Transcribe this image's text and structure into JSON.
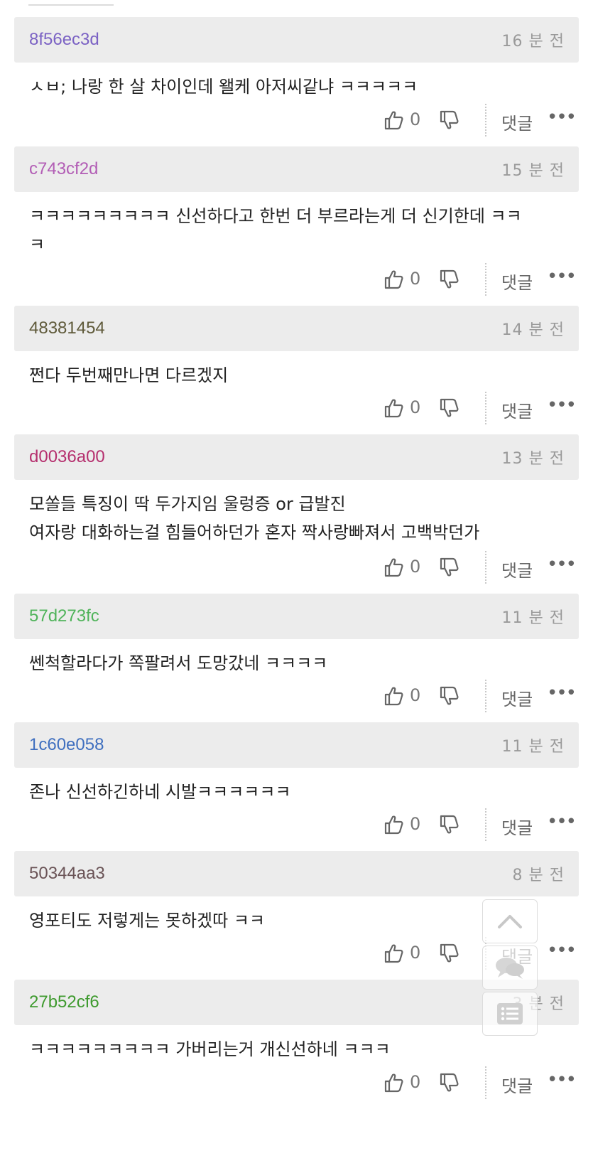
{
  "comments": [
    {
      "user": "8f56ec3d",
      "user_color": "#7b62c4",
      "time": "16 분 전",
      "text": "ㅅㅂ; 나랑 한 살 차이인데 왤케 아저씨같냐 ㅋㅋㅋㅋㅋ",
      "likes": "0",
      "reply_label": "댓글",
      "more_label": "•••"
    },
    {
      "user": "c743cf2d",
      "user_color": "#b25db5",
      "time": "15 분 전",
      "text": "ㅋㅋㅋㅋㅋㅋㅋㅋㅋ 신선하다고 한번 더 부르라는게 더 신기한데 ㅋㅋ\nㅋ",
      "likes": "0",
      "reply_label": "댓글",
      "more_label": "•••"
    },
    {
      "user": "48381454",
      "user_color": "#5f5a3a",
      "time": "14 분 전",
      "text": "쩐다 두번째만나면 다르겠지",
      "likes": "0",
      "reply_label": "댓글",
      "more_label": "•••"
    },
    {
      "user": "d0036a00",
      "user_color": "#b52f6e",
      "time": "13 분 전",
      "text": "모쏠들 특징이 딱 두가지임 울렁증 or 급발진\n여자랑 대화하는걸 힘들어하던가 혼자 짝사랑빠져서 고백박던가",
      "likes": "0",
      "reply_label": "댓글",
      "more_label": "•••"
    },
    {
      "user": "57d273fc",
      "user_color": "#4fb35a",
      "time": "11 분 전",
      "text": "쎈척할라다가 쪽팔려서 도망갔네 ㅋㅋㅋㅋ",
      "likes": "0",
      "reply_label": "댓글",
      "more_label": "•••"
    },
    {
      "user": "1c60e058",
      "user_color": "#3f6fbf",
      "time": "11 분 전",
      "text": "존나 신선하긴하네 시발ㅋㅋㅋㅋㅋㅋ",
      "likes": "0",
      "reply_label": "댓글",
      "more_label": "•••"
    },
    {
      "user": "50344aa3",
      "user_color": "#6a5356",
      "time": "8 분 전",
      "text": "영포티도 저렇게는 못하겠따 ㅋㅋ",
      "likes": "0",
      "reply_label": "댓글",
      "more_label": "•••"
    },
    {
      "user": "27b52cf6",
      "user_color": "#3e9a2e",
      "time": "3 분 전",
      "text": "ㅋㅋㅋㅋㅋㅋㅋㅋㅋ 가버리는거 개신선하네 ㅋㅋㅋ",
      "likes": "0",
      "reply_label": "댓글",
      "more_label": "•••"
    }
  ],
  "floating": {
    "top_icon": "chevron-up-icon",
    "comments_icon": "chat-bubbles-icon",
    "list_icon": "list-icon"
  }
}
